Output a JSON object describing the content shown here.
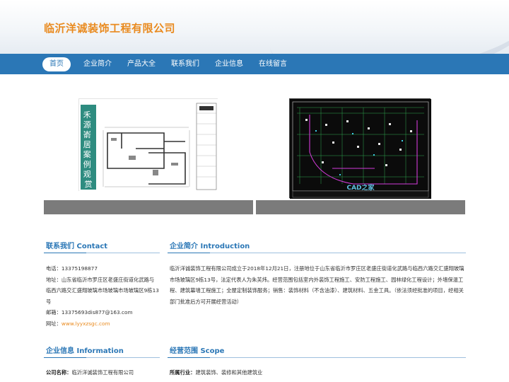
{
  "site": {
    "title": "临沂洋诚装饰工程有限公司"
  },
  "nav": {
    "items": [
      {
        "label": "首页"
      },
      {
        "label": "企业简介"
      },
      {
        "label": "产品大全"
      },
      {
        "label": "联系我们"
      },
      {
        "label": "企业信息"
      },
      {
        "label": "在线留言"
      }
    ]
  },
  "banner": {
    "left_caption": "禾源嵛居案例观赏",
    "right_watermark": "CAD之家"
  },
  "contact": {
    "title": "联系我们 Contact",
    "phone": "电话：13375198877",
    "address": "地址：山东省临沂市罗庄区老盛庄街道化武路与临西六路交汇盛翔玻璃市场玻璃市场玻璃区9栋13号",
    "email": "邮箱：13375693dis877@163.com",
    "website_label": "网址：",
    "website": "www.lyyxzsgc.com"
  },
  "intro": {
    "title": "企业简介 Introduction",
    "body": "临沂洋诚装饰工程有限公司成立于2018年12月21日，注册地位于山东省临沂市罗庄区老盛庄街道化武路与临西六路交汇盛翔玻璃市场玻璃区9栋13号，法定代表人为朱芙炜。经营范围包括室内外装饰工程施工、安防工程施工、园林绿化工程设计；外墙保温工程、建筑幕墙工程施工；全屋定制装饰服务；销售：装饰材料（不含油漆）、建筑材料、五金工具。（依法须经批准的项目，经相关部门批准后方可开展经营活动）"
  },
  "info": {
    "title": "企业信息 Information",
    "company_label": "公司名称：",
    "company_name": "临沂洋诚装饰工程有限公司"
  },
  "scope": {
    "title": "经营范围 Scope",
    "industry_label": "所属行业：",
    "industry": "建筑装饰、装修和其他建筑业"
  }
}
